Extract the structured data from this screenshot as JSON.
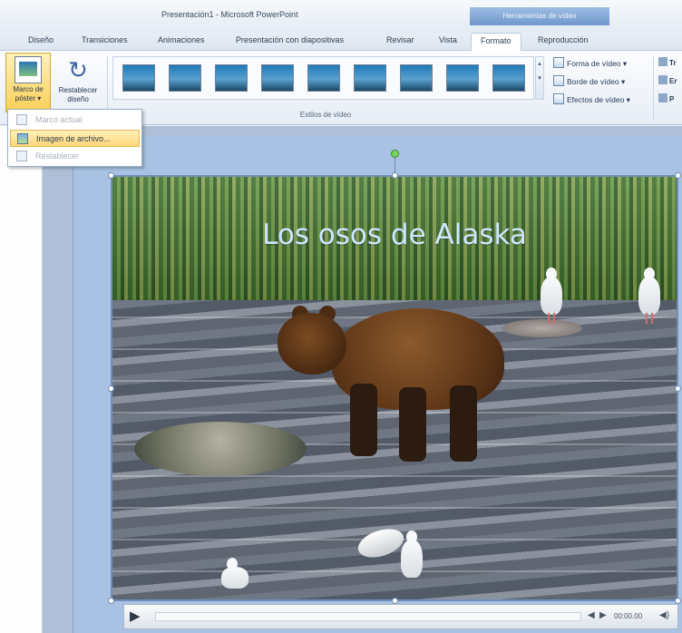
{
  "window": {
    "title": "Presentación1 - Microsoft PowerPoint",
    "context_tab_group": "Herramientas de vídeo"
  },
  "tabs": [
    "Diseño",
    "Transiciones",
    "Animaciones",
    "Presentación con diapositivas",
    "Revisar",
    "Vista",
    "Formato",
    "Reproducción"
  ],
  "active_tab": "Formato",
  "ribbon": {
    "poster_frame_button": "Marco de póster ▾",
    "reset_design_button": "Restablecer diseño",
    "styles_group_label": "Estilos de vídeo",
    "video_shape": "Forma de vídeo ▾",
    "video_border": "Borde de vídeo ▾",
    "video_effects": "Efectos de vídeo ▾",
    "cut_commands": [
      "Tr",
      "Er",
      "P"
    ]
  },
  "dropdown": {
    "items": [
      {
        "label": "Marco actual",
        "enabled": false
      },
      {
        "label": "Imagen de archivo...",
        "enabled": true
      },
      {
        "label": "Restablecer",
        "enabled": false
      }
    ]
  },
  "slide": {
    "title": "Los osos de Alaska"
  },
  "player": {
    "time": "00:00.00"
  },
  "colors": {
    "accent": "#6f98cc",
    "selection": "#6f8fb8",
    "highlight": "#ffd87a"
  },
  "icons": [
    "poster-frame-icon",
    "reset-design-icon",
    "video-shape-icon",
    "video-border-icon",
    "video-effects-icon",
    "play-icon",
    "volume-icon"
  ]
}
